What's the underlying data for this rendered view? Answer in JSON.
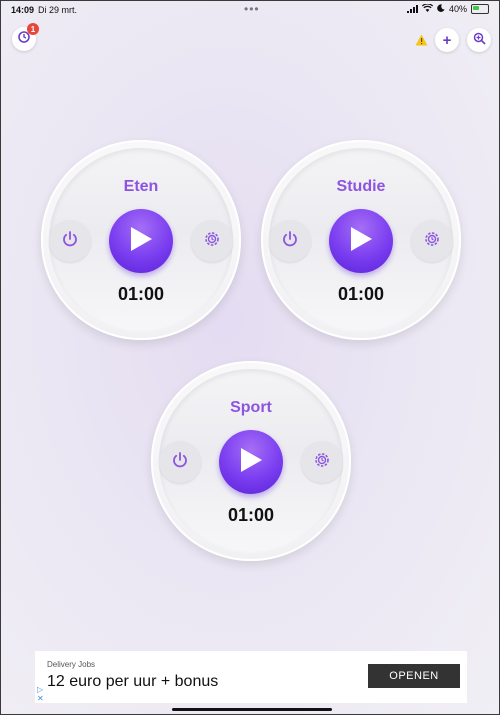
{
  "status": {
    "time": "14:09",
    "date": "Di 29 mrt.",
    "battery": "40%"
  },
  "toolbar": {
    "notifications_count": "1",
    "add_label": "+",
    "zoom_icon": "zoom-in-icon"
  },
  "timers": [
    {
      "name": "Eten",
      "time": "01:00"
    },
    {
      "name": "Studie",
      "time": "01:00"
    },
    {
      "name": "Sport",
      "time": "01:00"
    }
  ],
  "ad": {
    "subtitle": "Delivery Jobs",
    "headline": "12 euro per uur + bonus",
    "cta": "OPENEN"
  },
  "colors": {
    "accent": "#7a3df0",
    "title": "#8c54e0",
    "warning": "#f5c518"
  }
}
